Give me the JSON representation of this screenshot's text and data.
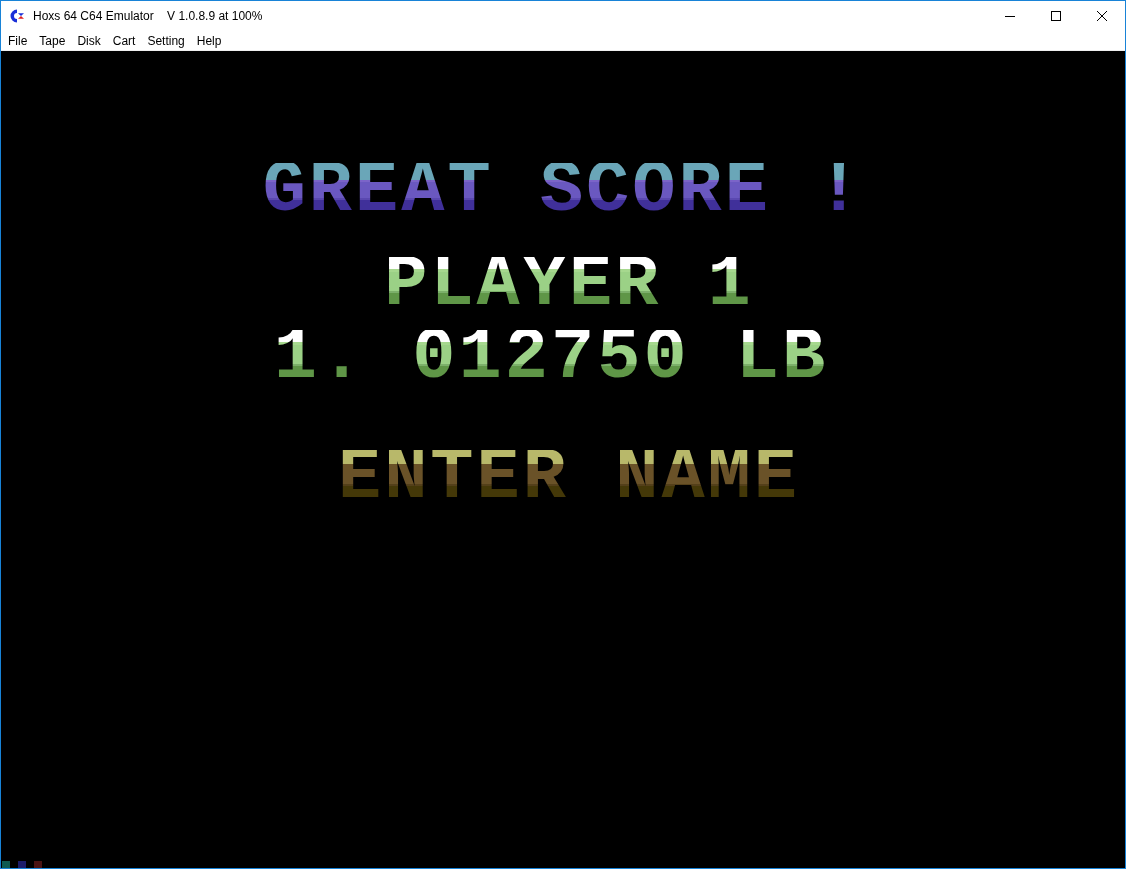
{
  "window": {
    "title": "Hoxs 64 C64 Emulator    V 1.0.8.9 at 100%"
  },
  "menu": [
    "File",
    "Tape",
    "Disk",
    "Cart",
    "Setting",
    "Help"
  ],
  "screen": {
    "lines": [
      {
        "kind": "title",
        "text": "GREAT SCORE !"
      },
      {
        "kind": "player",
        "text": "PLAYER 1"
      },
      {
        "kind": "score",
        "text": "1. 012750 LB"
      },
      {
        "kind": "prompt",
        "text": "ENTER NAME"
      }
    ]
  },
  "status_indicators": [
    {
      "color": "#0e5a52"
    },
    {
      "color": "#1c1c6a"
    },
    {
      "color": "#4a1414"
    }
  ]
}
